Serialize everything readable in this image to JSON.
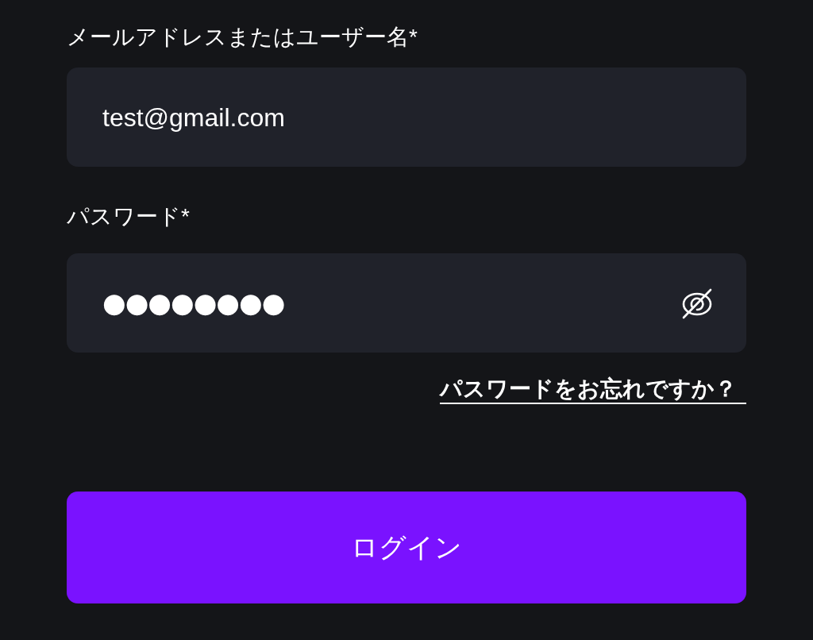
{
  "fields": [
    {
      "kind": "text",
      "label": "メールアドレスまたはユーザー名*",
      "value": "test@gmail.com"
    },
    {
      "kind": "password",
      "label": "パスワード*",
      "value": "●●●●●●●●"
    }
  ],
  "forgot_link": "パスワードをお忘れですか？",
  "login_button": "ログイン"
}
